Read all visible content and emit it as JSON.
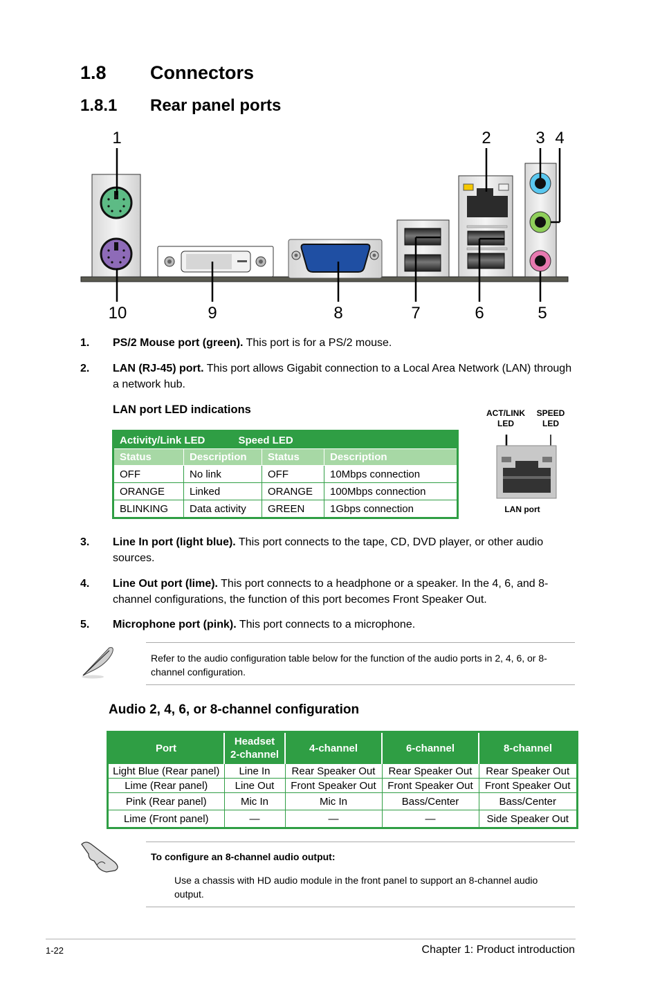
{
  "heading": {
    "number": "1.8",
    "title": "Connectors"
  },
  "subheading": {
    "number": "1.8.1",
    "title": "Rear panel ports"
  },
  "diagram": {
    "top_labels": [
      "1",
      "2",
      "3",
      "4"
    ],
    "bottom_labels": [
      "10",
      "9",
      "8",
      "7",
      "6",
      "5"
    ],
    "colors": {
      "ps2_mouse": "#5dbb85",
      "ps2_keyboard": "#8e6bb8",
      "vga": "#1f4fa3",
      "line_in": "#5ac8f0",
      "line_out": "#8fcf5a",
      "mic": "#e879b0",
      "lan_led_left": "#f5c800",
      "panel": "#5a5a50"
    }
  },
  "items": [
    {
      "num": "1.",
      "bold": "PS/2 Mouse port (green).",
      "text": " This port is for a PS/2 mouse."
    },
    {
      "num": "2.",
      "bold": "LAN (RJ-45) port.",
      "text": " This port allows Gigabit connection to a Local Area Network (LAN) through a network hub."
    },
    {
      "num": "3.",
      "bold": "Line In port (light blue).",
      "text": " This port connects to the tape, CD, DVD player, or other audio sources."
    },
    {
      "num": "4.",
      "bold": "Line Out port (lime).",
      "text": " This port connects to a headphone or a speaker. In the 4, 6, and 8-channel configurations, the function of this port becomes Front Speaker Out."
    },
    {
      "num": "5.",
      "bold": "Microphone port (pink).",
      "text": " This port connects to a microphone."
    }
  ],
  "lan_led": {
    "title": "LAN port LED indications",
    "group_headers": [
      "Activity/Link LED",
      "Speed LED"
    ],
    "columns": [
      "Status",
      "Description",
      "Status",
      "Description"
    ],
    "rows": [
      [
        "OFF",
        "No link",
        "OFF",
        "10Mbps connection"
      ],
      [
        "ORANGE",
        "Linked",
        "ORANGE",
        "100Mbps connection"
      ],
      [
        "BLINKING",
        "Data activity",
        "GREEN",
        "1Gbps connection"
      ]
    ],
    "figure": {
      "act_label_1": "ACT/LINK",
      "act_label_2": "LED",
      "speed_label_1": "SPEED",
      "speed_label_2": "LED",
      "caption": "LAN port"
    }
  },
  "note": {
    "icon": "pen-note-icon",
    "text": "Refer to the audio configuration table below for the function of the audio ports in 2, 4, 6, or 8-channel configuration."
  },
  "audio": {
    "title": "Audio 2, 4, 6, or 8-channel configuration",
    "columns": [
      "Port",
      "Headset\n2-channel",
      "4-channel",
      "6-channel",
      "8-channel"
    ],
    "col_headset_1": "Headset",
    "col_headset_2": "2-channel",
    "rows": [
      [
        "Light Blue (Rear panel)",
        "Line In",
        "Rear Speaker Out",
        "Rear Speaker Out",
        "Rear Speaker Out"
      ],
      [
        "Lime (Rear panel)",
        "Line Out",
        "Front Speaker Out",
        "Front Speaker Out",
        "Front Speaker Out"
      ],
      [
        "Pink (Rear panel)",
        "Mic In",
        "Mic In",
        "Bass/Center",
        "Bass/Center"
      ],
      [
        "Lime (Front panel)",
        "—",
        "—",
        "—",
        "Side Speaker Out"
      ]
    ]
  },
  "tip": {
    "icon": "hand-pointer-icon",
    "title": "To configure an 8-channel audio output:",
    "text": "Use a chassis with HD audio module in the front panel to support an 8-channel audio output."
  },
  "footer": {
    "page": "1-22",
    "chapter": "Chapter 1: Product introduction"
  }
}
